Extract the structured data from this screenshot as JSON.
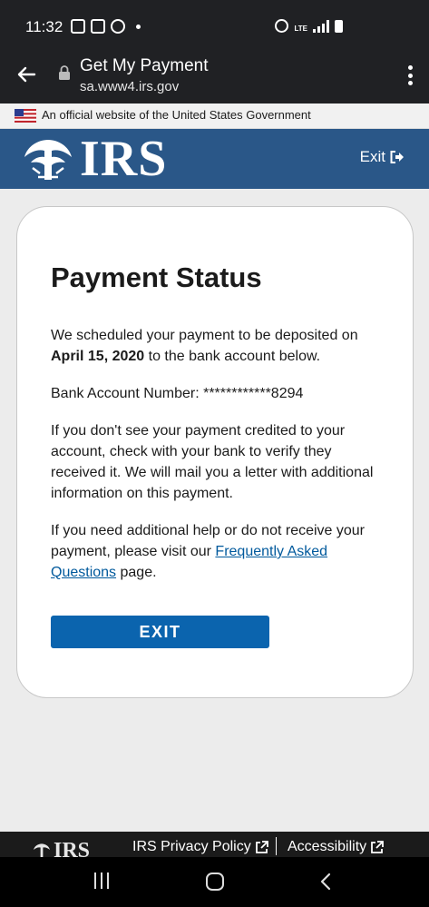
{
  "status_bar": {
    "time": "11:32",
    "lte": "LTE"
  },
  "browser": {
    "title": "Get My Payment",
    "url": "sa.www4.irs.gov"
  },
  "gov_banner": {
    "text": "An official website of the United States Government"
  },
  "header": {
    "logo_text": "IRS",
    "exit_label": "Exit"
  },
  "card": {
    "title": "Payment Status",
    "p1_before": "We scheduled your payment to be deposited on ",
    "p1_date": "April 15, 2020",
    "p1_after": " to the bank account below.",
    "account_line": "Bank Account Number: ************8294",
    "p3": "If you don't see your payment credited to your account, check with your bank to verify they received it. We will mail you a letter with additional information on this payment.",
    "p4_before": "If you need additional help or do not receive your payment, please visit our ",
    "p4_link": "Frequently Asked Questions",
    "p4_after": " page.",
    "exit_button": "EXIT"
  },
  "footer": {
    "logo_text": "IRS",
    "privacy_link": "IRS Privacy Policy",
    "accessibility_link": "Accessibility"
  },
  "colors": {
    "header_blue": "#2a5788",
    "button_blue": "#0b64ae",
    "link_blue": "#00599c",
    "chrome_dark": "#202124"
  }
}
